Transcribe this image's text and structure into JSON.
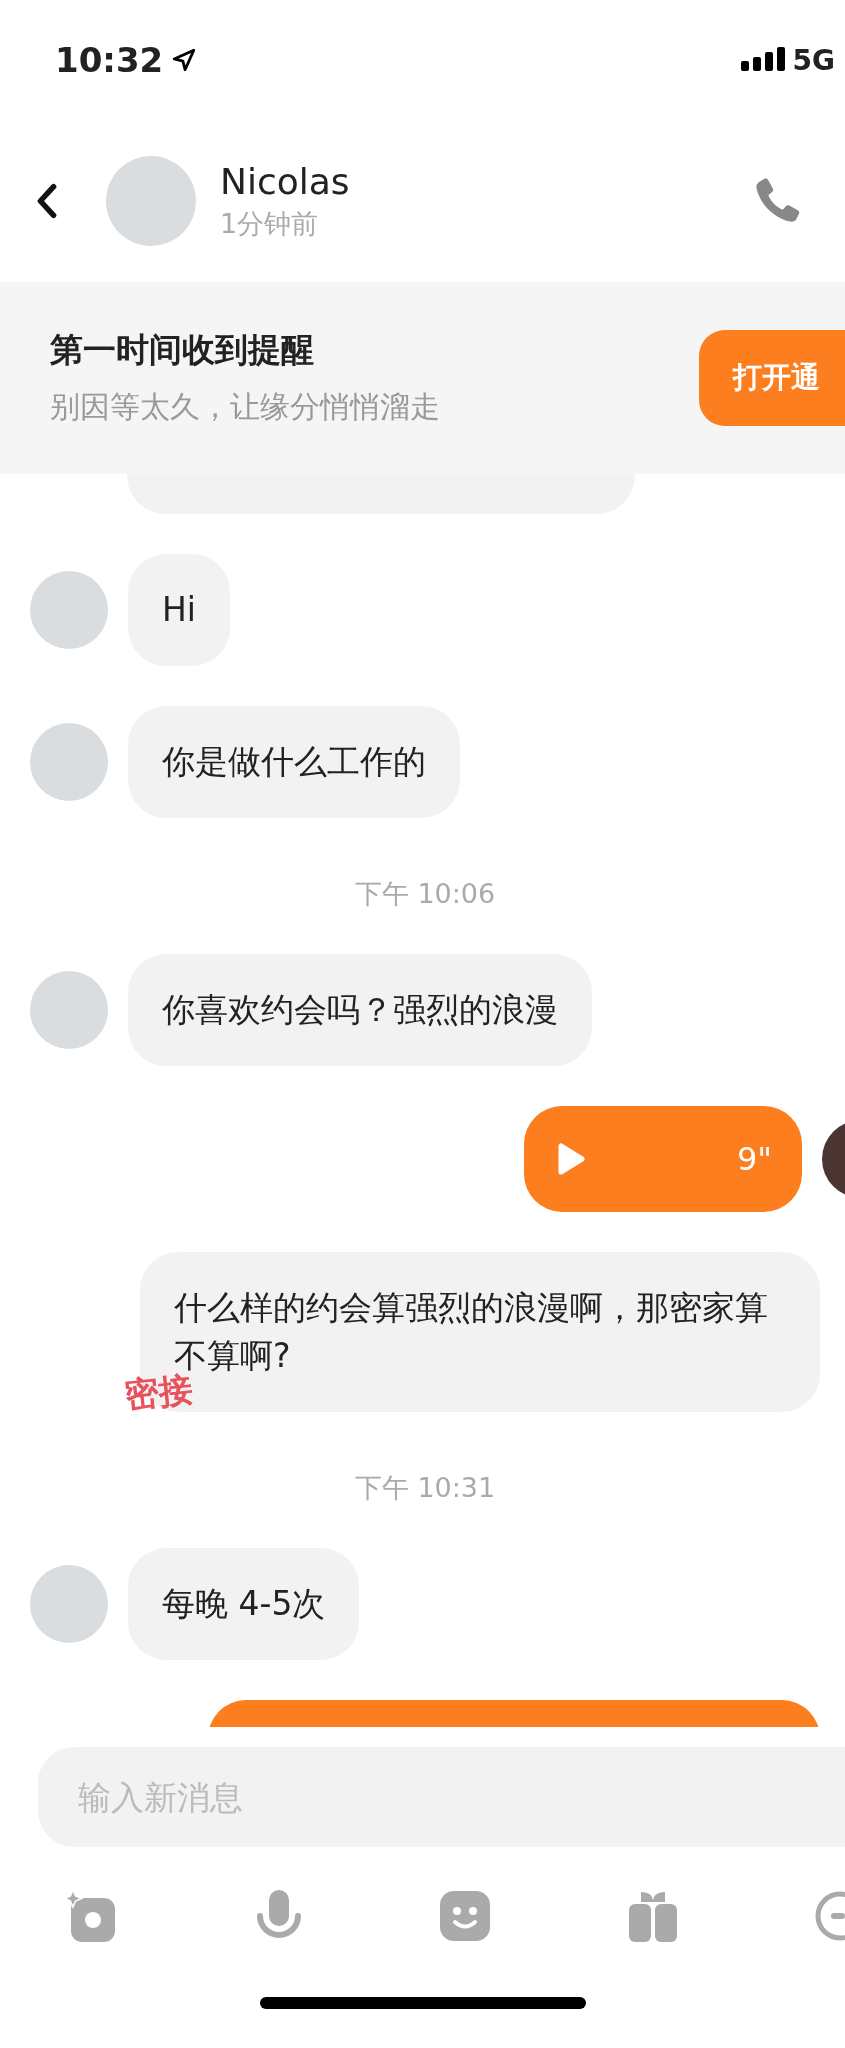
{
  "status_bar": {
    "time": "10:32",
    "network": "5G"
  },
  "header": {
    "name": "Nicolas",
    "last_seen": "1分钟前"
  },
  "notification_banner": {
    "title": "第一时间收到提醒",
    "subtitle": "别因等太久，让缘分悄悄溜走",
    "button": "打开通"
  },
  "messages": [
    {
      "kind": "stub_in"
    },
    {
      "kind": "text_in",
      "avatar": true,
      "text": "Hi"
    },
    {
      "kind": "text_in",
      "avatar": true,
      "text": "你是做什么工作的"
    },
    {
      "kind": "time",
      "text": "下午 10:06"
    },
    {
      "kind": "text_in",
      "avatar": true,
      "text": "你喜欢约会吗？强烈的浪漫"
    },
    {
      "kind": "voice_out",
      "avatar": true,
      "duration": "9\""
    },
    {
      "kind": "text_in",
      "avatar": false,
      "text": "什么样的约会算强烈的浪漫啊，那密家算不算啊?",
      "annotation": "密接"
    },
    {
      "kind": "time",
      "text": "下午 10:31"
    },
    {
      "kind": "text_in",
      "avatar": true,
      "text": "每晚 4-5次"
    },
    {
      "kind": "stub_out"
    }
  ],
  "composer": {
    "placeholder": "输入新消息"
  }
}
